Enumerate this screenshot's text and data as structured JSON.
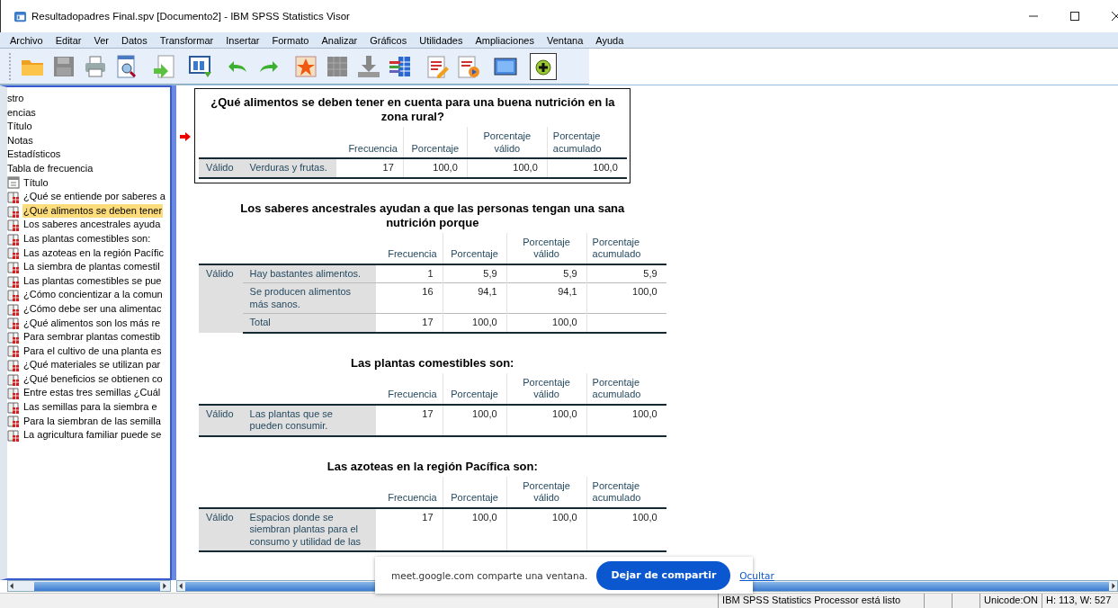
{
  "window": {
    "title": "Resultadopadres Final.spv [Documento2] - IBM SPSS Statistics Visor"
  },
  "menu": [
    {
      "label": "Archivo"
    },
    {
      "label": "Editar"
    },
    {
      "label": "Ver"
    },
    {
      "label": "Datos"
    },
    {
      "label": "Transformar"
    },
    {
      "label": "Insertar"
    },
    {
      "label": "Formato"
    },
    {
      "label": "Analizar"
    },
    {
      "label": "Gráficos"
    },
    {
      "label": "Utilidades"
    },
    {
      "label": "Ampliaciones"
    },
    {
      "label": "Ventana"
    },
    {
      "label": "Ayuda"
    }
  ],
  "tree": [
    {
      "label": "stro",
      "selected": false
    },
    {
      "label": "encias",
      "selected": false
    },
    {
      "label": "Título",
      "selected": false
    },
    {
      "label": "Notas",
      "selected": false
    },
    {
      "label": "Estadísticos",
      "selected": false
    },
    {
      "label": "Tabla de frecuencia",
      "selected": false,
      "children": [
        {
          "label": "Título",
          "kind": "title",
          "selected": false
        },
        {
          "label": "¿Qué se entiende por saberes a",
          "kind": "table",
          "selected": false
        },
        {
          "label": "¿Qué alimentos se deben tener",
          "kind": "table",
          "selected": true
        },
        {
          "label": "Los saberes ancestrales ayuda",
          "kind": "table",
          "selected": false
        },
        {
          "label": "Las plantas comestibles son:",
          "kind": "table",
          "selected": false
        },
        {
          "label": "Las azoteas en la región Pacífic",
          "kind": "table",
          "selected": false
        },
        {
          "label": "La siembra de plantas comestil",
          "kind": "table",
          "selected": false
        },
        {
          "label": "Las plantas comestibles se pue",
          "kind": "table",
          "selected": false
        },
        {
          "label": "¿Cómo concientizar a la comun",
          "kind": "table",
          "selected": false
        },
        {
          "label": "¿Cómo debe ser una alimentac",
          "kind": "table",
          "selected": false
        },
        {
          "label": "¿Qué alimentos son los más re",
          "kind": "table",
          "selected": false
        },
        {
          "label": "Para sembrar plantas comestib",
          "kind": "table",
          "selected": false
        },
        {
          "label": "Para el cultivo de una planta es",
          "kind": "table",
          "selected": false
        },
        {
          "label": "¿Qué materiales se utilizan par",
          "kind": "table",
          "selected": false
        },
        {
          "label": "¿Qué beneficios se obtienen co",
          "kind": "table",
          "selected": false
        },
        {
          "label": "Entre estas tres semillas ¿Cuál",
          "kind": "table",
          "selected": false
        },
        {
          "label": "Las semillas para la siembra e",
          "kind": "table",
          "selected": false
        },
        {
          "label": "Para la siembran de las semilla",
          "kind": "table",
          "selected": false
        },
        {
          "label": "La agricultura familiar puede se",
          "kind": "table",
          "selected": false
        }
      ]
    }
  ],
  "tables": [
    {
      "title": "¿Qué alimentos se deben tener en cuenta para una buena nutrición en la zona rural?",
      "selected": true,
      "columns": [
        "Frecuencia",
        "Porcentaje",
        "Porcentaje válido",
        "Porcentaje acumulado"
      ],
      "group": "Válido",
      "rows": [
        {
          "label": "Verduras y frutas.",
          "values": [
            "17",
            "100,0",
            "100,0",
            "100,0"
          ]
        }
      ]
    },
    {
      "title": "Los saberes ancestrales ayudan a que las personas tengan una sana nutrición porque",
      "selected": false,
      "columns": [
        "Frecuencia",
        "Porcentaje",
        "Porcentaje válido",
        "Porcentaje acumulado"
      ],
      "group": "Válido",
      "rows": [
        {
          "label": "Hay bastantes alimentos.",
          "values": [
            "1",
            "5,9",
            "5,9",
            "5,9"
          ]
        },
        {
          "label": "Se producen alimentos más sanos.",
          "values": [
            "16",
            "94,1",
            "94,1",
            "100,0"
          ]
        },
        {
          "label": "Total",
          "values": [
            "17",
            "100,0",
            "100,0"
          ]
        }
      ]
    },
    {
      "title": "Las plantas comestibles son:",
      "selected": false,
      "columns": [
        "Frecuencia",
        "Porcentaje",
        "Porcentaje válido",
        "Porcentaje acumulado"
      ],
      "group": "Válido",
      "rows": [
        {
          "label": "Las plantas que se pueden consumir.",
          "values": [
            "17",
            "100,0",
            "100,0",
            "100,0"
          ]
        }
      ]
    },
    {
      "title": "Las azoteas en la región Pacífica son:",
      "selected": false,
      "columns": [
        "Frecuencia",
        "Porcentaje",
        "Porcentaje válido",
        "Porcentaje acumulado"
      ],
      "group": "Válido",
      "rows": [
        {
          "label": "Espacios donde se siembran plantas para el consumo y utilidad de las",
          "values": [
            "17",
            "100,0",
            "100,0",
            "100,0"
          ]
        }
      ]
    }
  ],
  "status_bar": {
    "message": "IBM SPSS Statistics Processor está listo",
    "unicode": "Unicode:ON",
    "size": "H: 113, W: 527"
  },
  "share_banner": {
    "text": "meet.google.com comparte una ventana.",
    "stop_button": "Dejar de compartir",
    "hide_link": "Ocultar"
  }
}
